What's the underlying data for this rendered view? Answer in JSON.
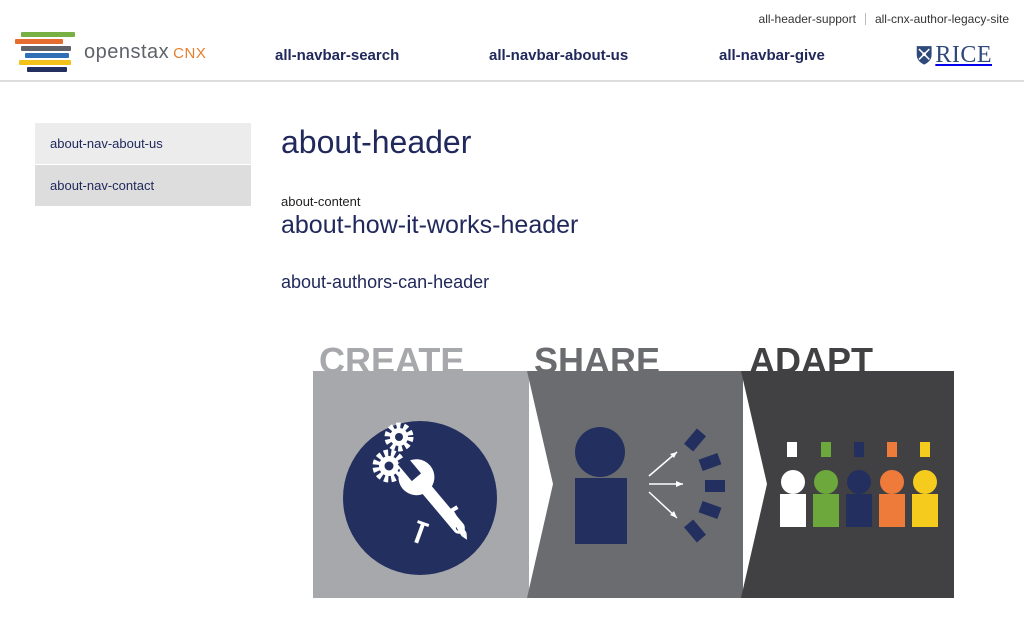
{
  "header": {
    "utility_links": [
      "all-header-support",
      "all-cnx-author-legacy-site"
    ],
    "logo": {
      "word": "openstax",
      "suffix": "CNX",
      "icon": "openstax-books-icon"
    },
    "nav": [
      "all-navbar-search",
      "all-navbar-about-us",
      "all-navbar-give"
    ],
    "partner_logo": {
      "icon": "rice-shield-icon",
      "word": "RICE"
    }
  },
  "sidebar": {
    "items": [
      "about-nav-about-us",
      "about-nav-contact"
    ]
  },
  "main": {
    "title": "about-header",
    "content_label": "about-content",
    "how_it_works_header": "about-how-it-works-header",
    "authors_can_header": "about-authors-can-header"
  },
  "illustration": {
    "panels": [
      "CREATE",
      "SHARE",
      "ADAPT"
    ],
    "colors": {
      "create": "#a7a8ab",
      "share": "#6b6c70",
      "adapt": "#414143",
      "navy": "#23305f",
      "white": "#ffffff",
      "green": "#6ca83c",
      "orange": "#ef7b3b",
      "yellow": "#f5cb1e"
    },
    "icons": [
      "gears-wrench-screw-icon",
      "person-broadcast-icon",
      "diverse-people-icon"
    ]
  },
  "colors": {
    "brand_navy": "#21295c",
    "logo_orange": "#e57f2f",
    "rice_blue": "#2f4a7a",
    "sidebar_active": "#ececec",
    "sidebar_alt": "#dddddd"
  }
}
